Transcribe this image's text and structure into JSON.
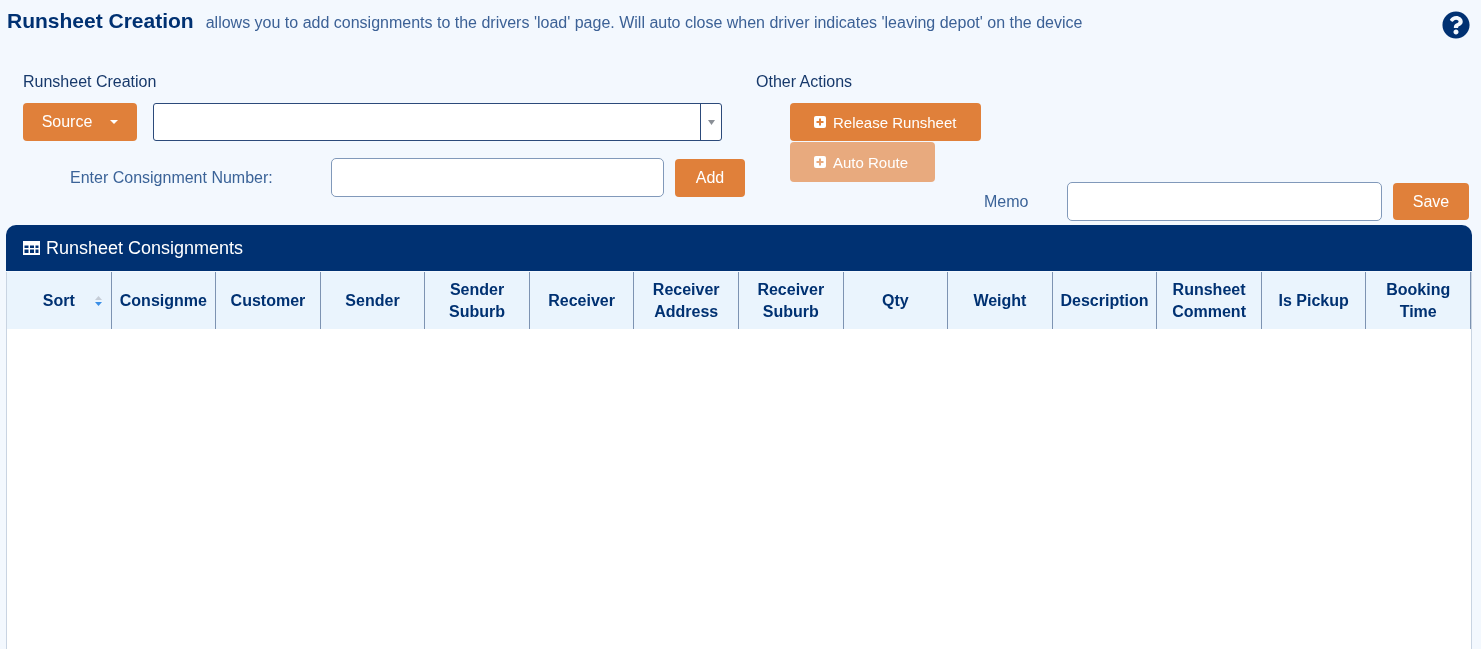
{
  "header": {
    "title": "Runsheet Creation",
    "description": "allows you to add consignments to the drivers 'load' page. Will auto close when driver indicates 'leaving depot' on the device"
  },
  "runsheet_creation": {
    "label": "Runsheet Creation",
    "source_button": "Source",
    "consignment_label": "Enter Consignment Number:",
    "add_button": "Add"
  },
  "other_actions": {
    "label": "Other Actions",
    "buttons": [
      {
        "label": "Release Runsheet",
        "disabled": false
      },
      {
        "label": "Auto Route",
        "disabled": true
      }
    ],
    "memo_label": "Memo",
    "save_button": "Save"
  },
  "panel": {
    "title": "Runsheet Consignments",
    "columns": [
      {
        "label": "Sort",
        "sort_descending": true
      },
      {
        "label": "Consignme"
      },
      {
        "label": "Customer"
      },
      {
        "label": "Sender"
      },
      {
        "label": "Sender Suburb"
      },
      {
        "label": "Receiver"
      },
      {
        "label": "Receiver Address"
      },
      {
        "label": "Receiver Suburb"
      },
      {
        "label": "Qty"
      },
      {
        "label": "Weight"
      },
      {
        "label": "Description"
      },
      {
        "label": "Runsheet Comment"
      },
      {
        "label": "Is Pickup"
      },
      {
        "label": "Booking Time"
      }
    ]
  }
}
